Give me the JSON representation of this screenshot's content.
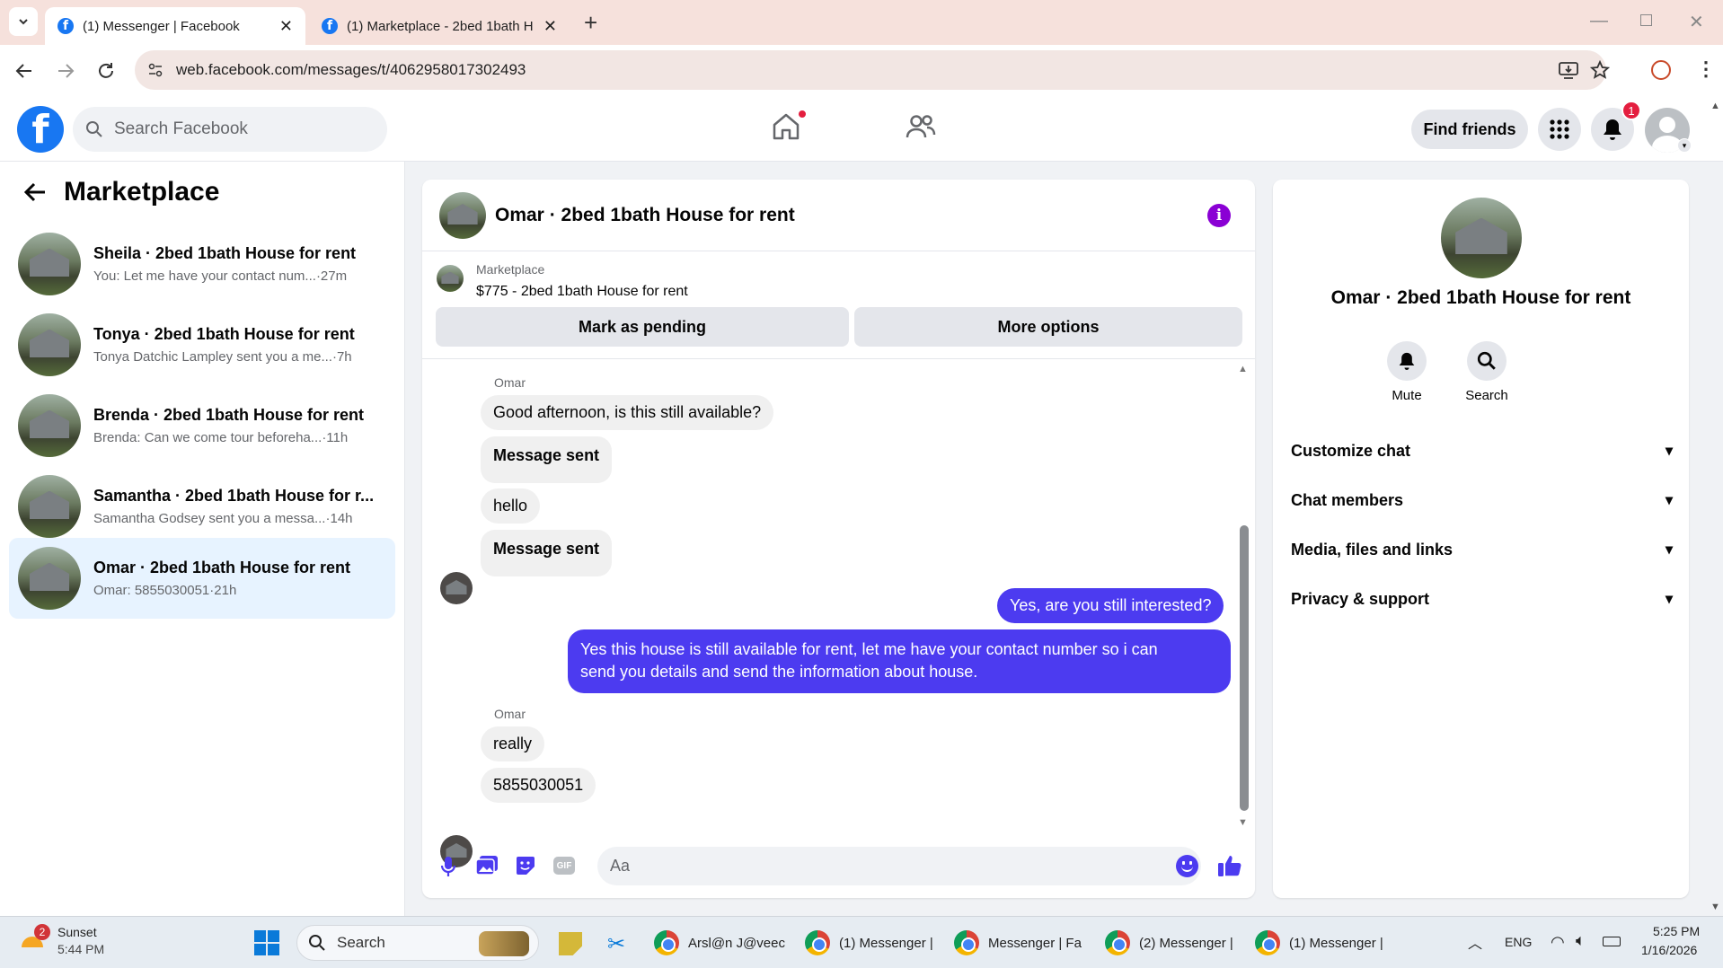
{
  "browser": {
    "tabs": [
      {
        "label": "(1) Messenger | Facebook",
        "active": true
      },
      {
        "label": "(1) Marketplace - 2bed 1bath H",
        "active": false
      }
    ],
    "url": "web.facebook.com/messages/t/4062958017302493"
  },
  "fb": {
    "search_placeholder": "Search Facebook",
    "find_friends": "Find friends",
    "notification_count": "1"
  },
  "left": {
    "title": "Marketplace",
    "conversations": [
      {
        "name": "Sheila · 2bed 1bath House for rent",
        "preview": "You: Let me have your contact num...",
        "time": "·27m"
      },
      {
        "name": "Tonya · 2bed 1bath House for rent",
        "preview": "Tonya Datchic Lampley sent you a me...",
        "time": "·7h"
      },
      {
        "name": "Brenda · 2bed 1bath House for rent",
        "preview": "Brenda: Can we come tour beforeha...",
        "time": "·11h"
      },
      {
        "name": "Samantha · 2bed 1bath House for r...",
        "preview": "Samantha Godsey sent you a messa...",
        "time": "·14h"
      },
      {
        "name": "Omar · 2bed 1bath House for rent",
        "preview": "Omar: 5855030051",
        "time": "·21h"
      }
    ]
  },
  "chat": {
    "title": "Omar · 2bed 1bath House for rent",
    "listing_source": "Marketplace",
    "listing": "$775 - 2bed 1bath House for rent",
    "mark_pending": "Mark as pending",
    "more_options": "More options",
    "sender1": "Omar",
    "m1": "Good afternoon, is this still available?",
    "m2": "Message sent",
    "m3": "hello",
    "m4": "Message sent",
    "o1": "Yes, are you still interested?",
    "o2_line1": "Yes this house is still available for rent, let me have your contact number so i can",
    "o2_line2": "send you details and send the information about house.",
    "sender2": "Omar",
    "m5": "really",
    "m6": "5855030051",
    "composer_placeholder": "Aa"
  },
  "right": {
    "title": "Omar · 2bed 1bath House for rent",
    "mute": "Mute",
    "search": "Search",
    "options": [
      "Customize chat",
      "Chat members",
      "Media, files and links",
      "Privacy & support"
    ]
  },
  "taskbar": {
    "weather_badge": "2",
    "weather_title": "Sunset",
    "weather_time": "5:44 PM",
    "search": "Search",
    "apps": [
      "Arsl@n J@veec",
      "(1) Messenger |",
      "Messenger | Fa",
      "(2) Messenger |",
      "(1) Messenger |"
    ],
    "lang": "ENG",
    "time": "5:25 PM",
    "date": "1/16/2026"
  },
  "colors": {
    "accent": "#1877f2",
    "outgoing": "#4c3bf0",
    "info": "#8a00d4"
  }
}
